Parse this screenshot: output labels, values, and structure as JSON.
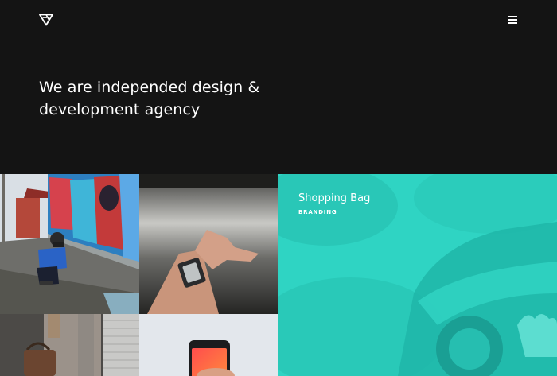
{
  "hero": {
    "title_line1": "We are independed design &",
    "title_line2": "development agency"
  },
  "featured": {
    "title": "Shopping Bag",
    "tag": "BRANDING"
  },
  "icons": {
    "logo": "triangle-logo-icon",
    "menu": "hamburger-menu-icon"
  },
  "colors": {
    "background": "#141414",
    "accent": "#2fd4c3",
    "text": "#ffffff"
  }
}
